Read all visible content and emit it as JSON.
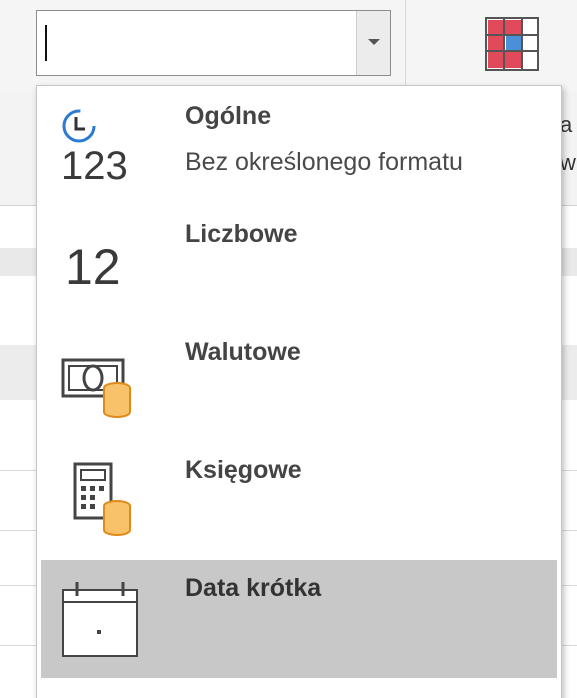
{
  "format_box": {
    "value": "",
    "dropdown_icon": "chevron-down-icon"
  },
  "ribbon": {
    "right_fragment_top": "a",
    "right_fragment_bottom": "w",
    "conditional_format_icon": "conditional-formatting-icon"
  },
  "format_menu": {
    "items": [
      {
        "title": "Ogólne",
        "subtitle": "Bez określonego formatu",
        "icon": "clock-123-icon",
        "icon_text": "123",
        "selected": false
      },
      {
        "title": "Liczbowe",
        "subtitle": "",
        "icon": "number-12-icon",
        "icon_text": "12",
        "selected": false
      },
      {
        "title": "Walutowe",
        "subtitle": "",
        "icon": "currency-coins-icon",
        "selected": false
      },
      {
        "title": "Księgowe",
        "subtitle": "",
        "icon": "calculator-coins-icon",
        "selected": false
      },
      {
        "title": "Data krótka",
        "subtitle": "",
        "icon": "calendar-icon",
        "selected": true
      }
    ]
  },
  "colors": {
    "selected_bg": "#c8c8c8",
    "coin_orange": "#f0a030",
    "clock_blue": "#2b7bd4",
    "cf_red": "#e04a5a",
    "cf_blue": "#4a90d9"
  }
}
